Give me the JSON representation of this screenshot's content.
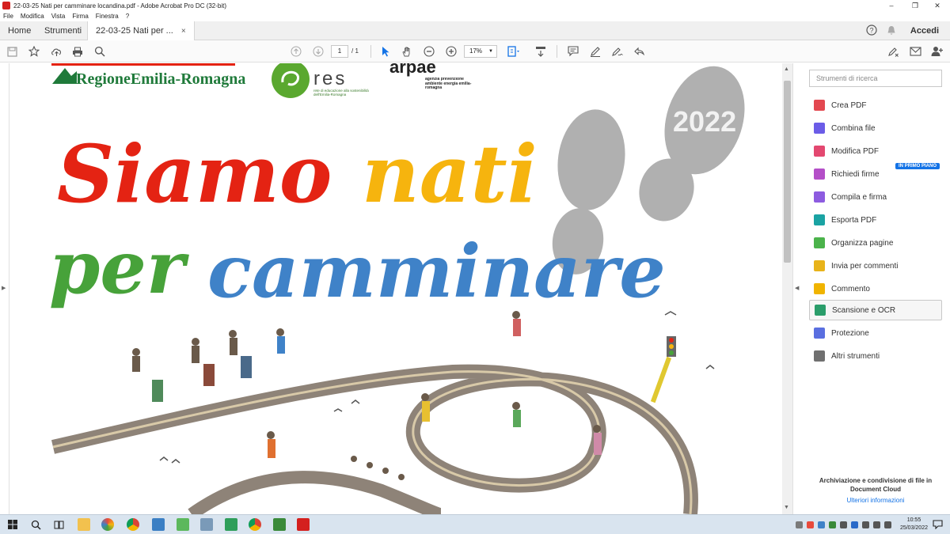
{
  "window": {
    "title": "22-03-25 Nati per camminare locandina.pdf - Adobe Acrobat Pro DC (32-bit)",
    "controls": [
      "–",
      "❐",
      "✕"
    ]
  },
  "menu": [
    "File",
    "Modifica",
    "Vista",
    "Firma",
    "Finestra",
    "?"
  ],
  "tabs": {
    "home": "Home",
    "tools": "Strumenti",
    "document": "22-03-25 Nati per ...",
    "close": "×",
    "signin": "Accedi"
  },
  "toolbar": {
    "page_current": "1",
    "page_total": "/ 1",
    "zoom": "17%"
  },
  "document": {
    "region_logo": "RegioneEmilia-Romagna",
    "res_logo": "res",
    "res_sub": "rete di educazione alla sostenibilità dell'Emilia-Romagna",
    "arpae_logo": "arpae",
    "arpae_sub": "agenzia prevenzione ambiente energia emilia-romagna",
    "headline_1a": "Siamo",
    "headline_1b": "nati",
    "headline_2": "per camminare",
    "year": "2022",
    "colors": {
      "red": "#e42313",
      "yellow": "#f6b40e",
      "green": "#47a23a",
      "blue": "#3f82c8",
      "gray": "#b0b0b0"
    }
  },
  "tools_panel": {
    "search_placeholder": "Strumenti di ricerca",
    "badge": "IN PRIMO PIANO",
    "items": [
      {
        "label": "Crea PDF",
        "icon": "create-pdf-icon",
        "color": "#e34850"
      },
      {
        "label": "Combina file",
        "icon": "combine-files-icon",
        "color": "#6b5ce7"
      },
      {
        "label": "Modifica PDF",
        "icon": "edit-pdf-icon",
        "color": "#e34870"
      },
      {
        "label": "Richiedi firme",
        "icon": "request-signatures-icon",
        "color": "#b44fc8"
      },
      {
        "label": "Compila e firma",
        "icon": "fill-sign-icon",
        "color": "#8d5ce0"
      },
      {
        "label": "Esporta PDF",
        "icon": "export-pdf-icon",
        "color": "#1aa3a3"
      },
      {
        "label": "Organizza pagine",
        "icon": "organize-pages-icon",
        "color": "#4bb34b"
      },
      {
        "label": "Invia per commenti",
        "icon": "send-comments-icon",
        "color": "#e8b31a"
      },
      {
        "label": "Commento",
        "icon": "comment-icon",
        "color": "#f0b400"
      },
      {
        "label": "Scansione e OCR",
        "icon": "scan-ocr-icon",
        "color": "#2a9d6a"
      },
      {
        "label": "Protezione",
        "icon": "protect-icon",
        "color": "#5a6fe0"
      },
      {
        "label": "Altri strumenti",
        "icon": "more-tools-icon",
        "color": "#707070"
      }
    ],
    "cloud_title": "Archiviazione e condivisione di file in Document Cloud",
    "cloud_link": "Ulteriori informazioni"
  },
  "taskbar": {
    "time": "10:55",
    "date": "25/03/2022"
  }
}
